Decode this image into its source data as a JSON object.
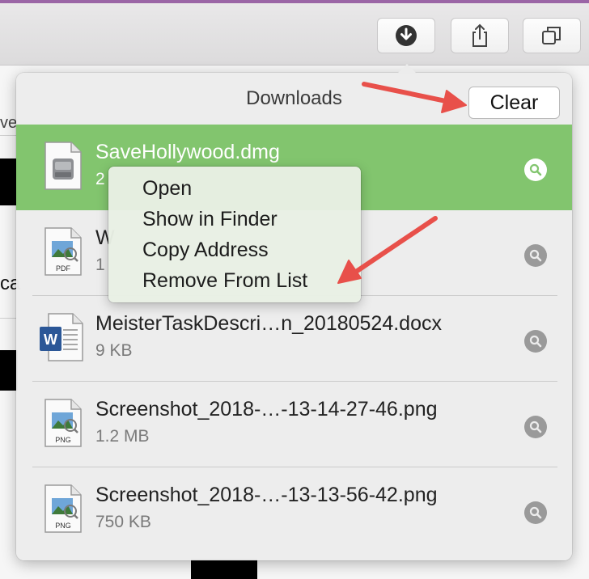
{
  "toolbar": {
    "buttons": [
      {
        "icon": "download-icon"
      },
      {
        "icon": "share-icon"
      },
      {
        "icon": "tabs-overview-icon"
      }
    ]
  },
  "background": {
    "snippets": [
      "ve",
      "ca"
    ]
  },
  "downloads": {
    "title": "Downloads",
    "clear_label": "Clear",
    "items": [
      {
        "name": "SaveHollywood.dmg",
        "size": "2",
        "icon": "dmg-file-icon",
        "selected": true
      },
      {
        "name": "W",
        "size": "1",
        "icon": "pdf-file-icon",
        "badge": "PDF",
        "selected": false
      },
      {
        "name": "MeisterTaskDescri…n_20180524.docx",
        "size": "9 KB",
        "icon": "word-file-icon",
        "selected": false
      },
      {
        "name": "Screenshot_2018-…-13-14-27-46.png",
        "size": "1.2 MB",
        "icon": "png-file-icon",
        "badge": "PNG",
        "selected": false
      },
      {
        "name": "Screenshot_2018-…-13-13-56-42.png",
        "size": "750 KB",
        "icon": "png-file-icon",
        "badge": "PNG",
        "selected": false
      }
    ]
  },
  "context_menu": {
    "items": [
      "Open",
      "Show in Finder",
      "Copy Address",
      "Remove From List"
    ]
  },
  "colors": {
    "selected_row": "#82c56e",
    "annotation_arrow": "#e8504a"
  }
}
